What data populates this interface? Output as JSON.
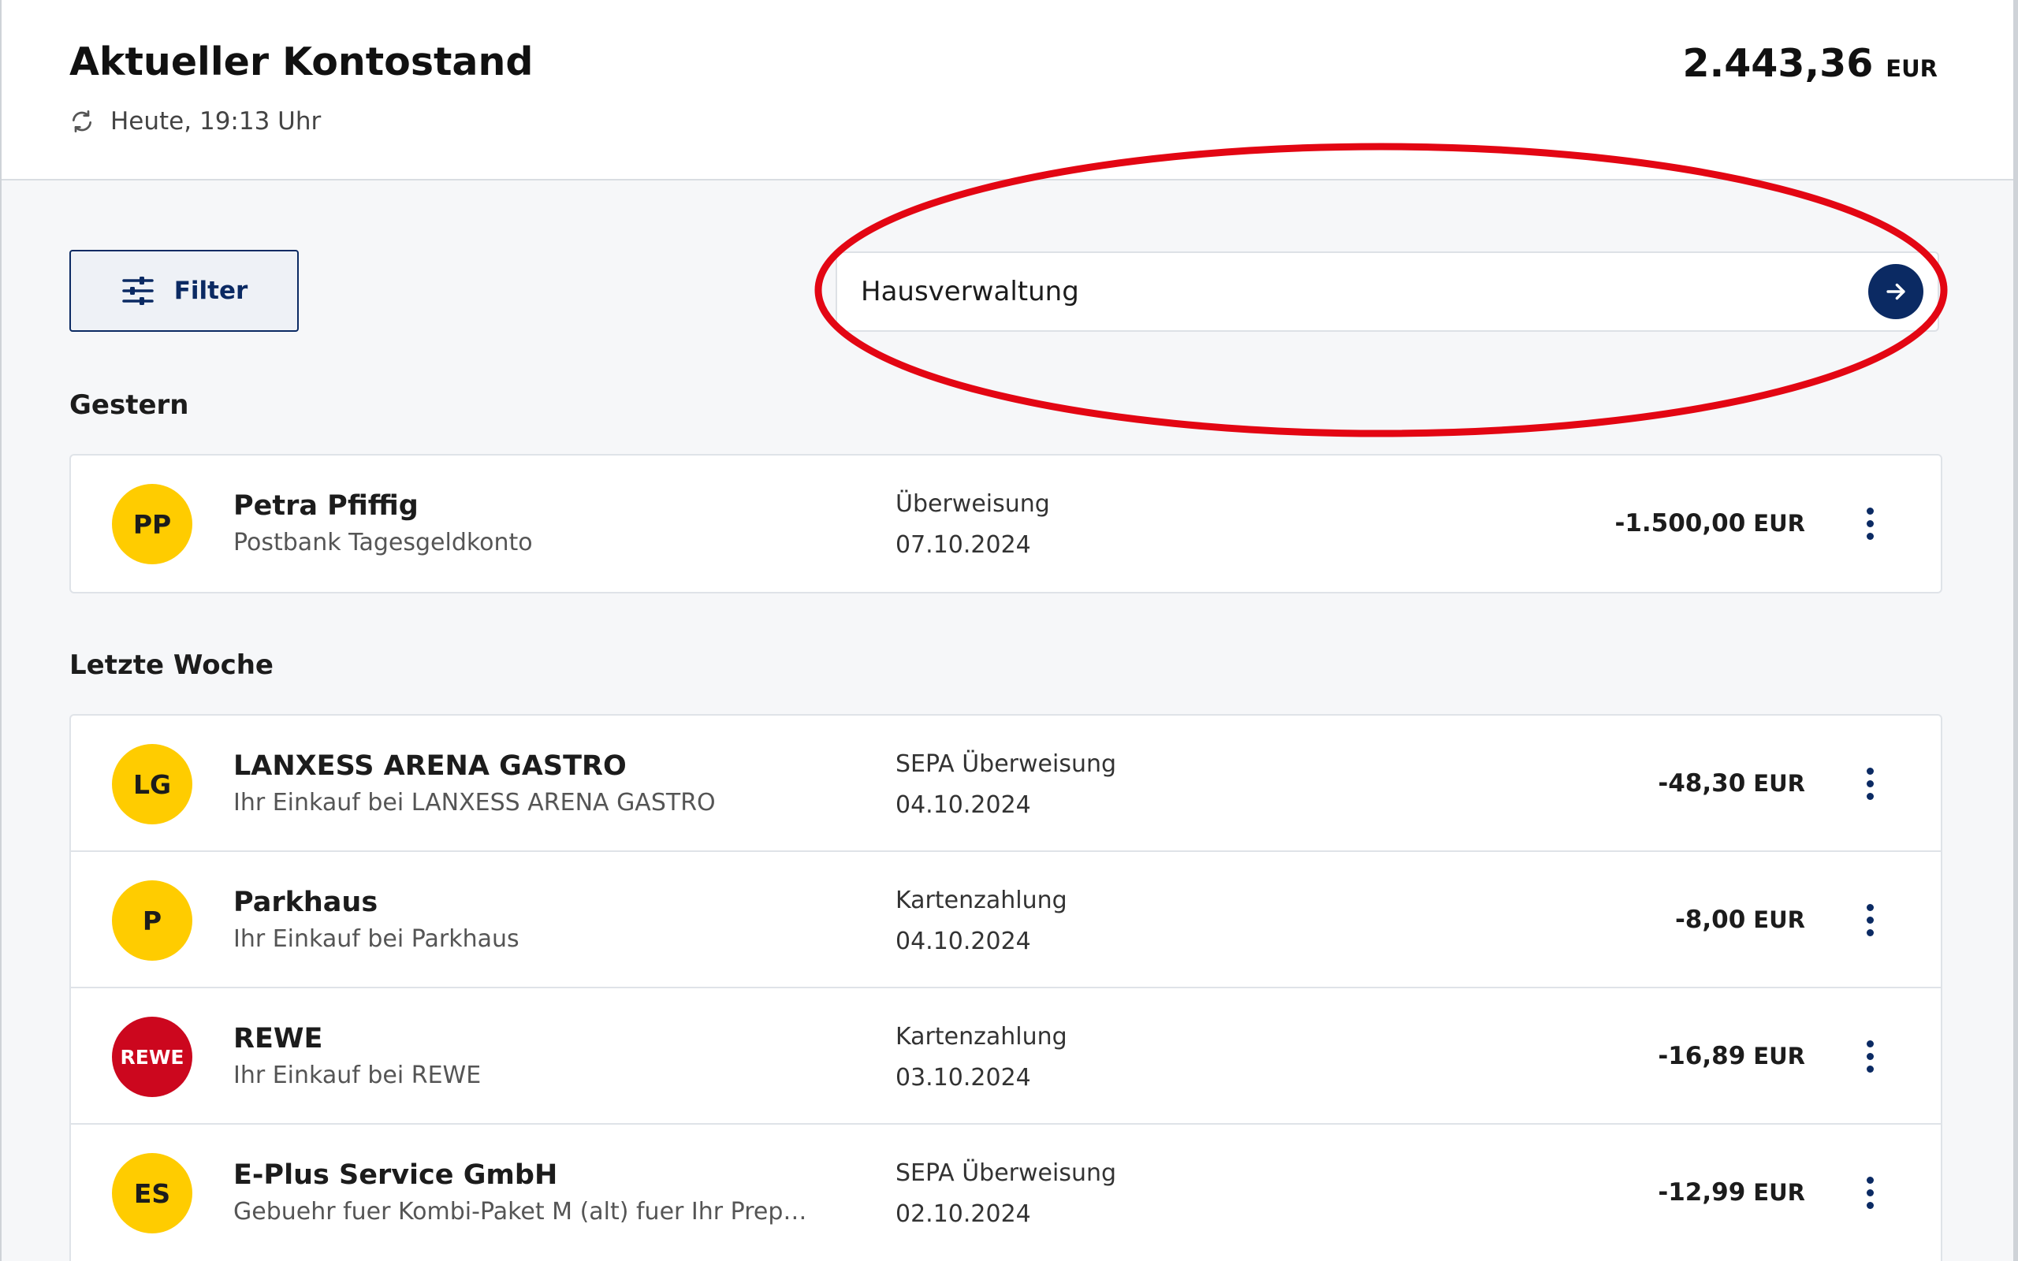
{
  "header": {
    "title": "Aktueller Kontostand",
    "updated": "Heute, 19:13 Uhr",
    "balance_amount": "2.443,36",
    "balance_currency": "EUR"
  },
  "toolbar": {
    "filter_label": "Filter",
    "search_value": "Hausverwaltung"
  },
  "annotation": {
    "color": "#e30613"
  },
  "sections": [
    {
      "label": "Gestern",
      "transactions": [
        {
          "initials": "PP",
          "name": "Petra Pfiffig",
          "description": "Postbank Tagesgeldkonto",
          "type": "Überweisung",
          "date": "07.10.2024",
          "amount": "-1.500,00",
          "currency": "EUR"
        }
      ]
    },
    {
      "label": "Letzte Woche",
      "transactions": [
        {
          "initials": "LG",
          "name": "LANXESS ARENA GASTRO",
          "description": "Ihr Einkauf bei LANXESS ARENA GASTRO",
          "type": "SEPA Überweisung",
          "date": "04.10.2024",
          "amount": "-48,30",
          "currency": "EUR"
        },
        {
          "initials": "P",
          "name": "Parkhaus",
          "description": "Ihr Einkauf bei Parkhaus",
          "type": "Kartenzahlung",
          "date": "04.10.2024",
          "amount": "-8,00",
          "currency": "EUR"
        },
        {
          "initials": "REWE",
          "name": "REWE",
          "description": "Ihr Einkauf bei REWE",
          "type": "Kartenzahlung",
          "date": "03.10.2024",
          "amount": "-16,89",
          "currency": "EUR"
        },
        {
          "initials": "ES",
          "name": "E-Plus Service GmbH",
          "description": "Gebuehr fuer Kombi-Paket M (alt) fuer Ihr Prepai…",
          "type": "SEPA Überweisung",
          "date": "02.10.2024",
          "amount": "-12,99",
          "currency": "EUR"
        }
      ]
    }
  ],
  "colors": {
    "brand": "#0b2a63",
    "avatar": "#ffcc00",
    "rewe": "#cc071e"
  }
}
